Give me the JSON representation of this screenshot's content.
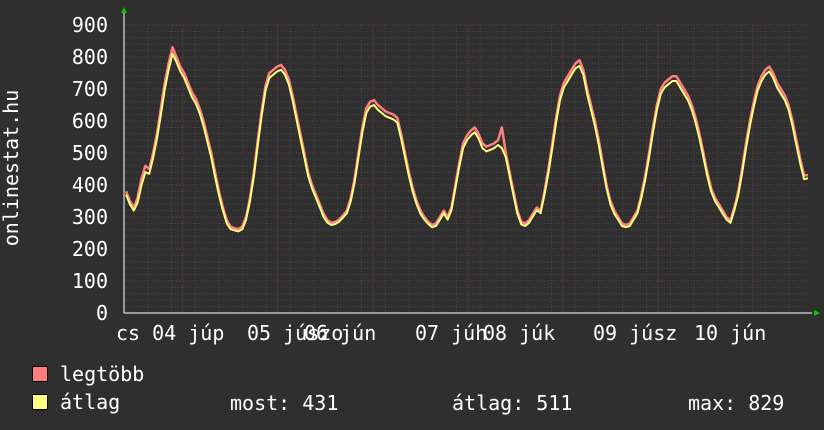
{
  "chart_data": {
    "type": "line",
    "ylabel": "onlinestat.hu",
    "ylim": [
      0,
      900
    ],
    "y_ticks": [
      "0",
      "100",
      "200",
      "300",
      "400",
      "500",
      "600",
      "700",
      "800",
      "900"
    ],
    "x_tick_labels": [
      "cs 04 júp",
      "05 júszo",
      "06 jún",
      "07 júh",
      "08 júk",
      "09 júsz",
      "10 jún"
    ],
    "series": [
      {
        "name": "legtöbb",
        "color": "#ff7f7f",
        "values": [
          380,
          350,
          330,
          360,
          420,
          460,
          450,
          500,
          560,
          640,
          720,
          780,
          830,
          800,
          770,
          750,
          720,
          690,
          670,
          640,
          600,
          550,
          500,
          440,
          380,
          330,
          290,
          270,
          265,
          262,
          270,
          300,
          360,
          440,
          540,
          630,
          710,
          750,
          760,
          770,
          775,
          760,
          730,
          680,
          620,
          560,
          500,
          440,
          400,
          370,
          340,
          310,
          290,
          282,
          285,
          292,
          305,
          320,
          360,
          420,
          500,
          580,
          640,
          660,
          665,
          650,
          640,
          630,
          625,
          620,
          610,
          560,
          500,
          440,
          390,
          350,
          320,
          300,
          285,
          275,
          280,
          300,
          320,
          300,
          330,
          400,
          470,
          530,
          555,
          570,
          580,
          560,
          530,
          520,
          525,
          530,
          540,
          580,
          500,
          440,
          380,
          320,
          285,
          280,
          290,
          310,
          330,
          320,
          380,
          450,
          530,
          610,
          680,
          720,
          740,
          760,
          780,
          790,
          760,
          700,
          650,
          600,
          540,
          470,
          400,
          350,
          320,
          300,
          280,
          275,
          280,
          300,
          320,
          370,
          430,
          500,
          580,
          650,
          700,
          720,
          730,
          740,
          740,
          720,
          700,
          680,
          650,
          610,
          560,
          500,
          440,
          390,
          360,
          340,
          320,
          300,
          290,
          330,
          380,
          450,
          530,
          600,
          660,
          710,
          740,
          760,
          770,
          750,
          720,
          700,
          680,
          650,
          600,
          540,
          480,
          430,
          431
        ]
      },
      {
        "name": "átlag",
        "color": "#ffff7f",
        "values": [
          370,
          340,
          320,
          345,
          400,
          440,
          435,
          485,
          545,
          620,
          700,
          760,
          810,
          785,
          755,
          735,
          705,
          675,
          655,
          625,
          585,
          535,
          485,
          425,
          368,
          320,
          280,
          262,
          258,
          255,
          262,
          292,
          350,
          428,
          525,
          615,
          695,
          735,
          745,
          755,
          760,
          745,
          715,
          665,
          605,
          545,
          487,
          428,
          390,
          360,
          330,
          300,
          282,
          275,
          278,
          285,
          298,
          312,
          350,
          408,
          487,
          565,
          625,
          645,
          650,
          635,
          625,
          615,
          610,
          605,
          595,
          545,
          487,
          428,
          378,
          340,
          310,
          292,
          278,
          268,
          272,
          292,
          312,
          292,
          322,
          390,
          457,
          515,
          540,
          555,
          565,
          545,
          515,
          505,
          510,
          515,
          525,
          515,
          487,
          428,
          368,
          310,
          277,
          272,
          282,
          302,
          322,
          312,
          370,
          437,
          515,
          595,
          665,
          705,
          725,
          745,
          765,
          772,
          745,
          685,
          635,
          585,
          525,
          457,
          390,
          340,
          310,
          292,
          272,
          268,
          272,
          292,
          312,
          360,
          418,
          487,
          565,
          635,
          685,
          705,
          715,
          725,
          725,
          705,
          685,
          665,
          635,
          595,
          545,
          487,
          428,
          380,
          350,
          330,
          310,
          292,
          282,
          322,
          370,
          437,
          515,
          585,
          645,
          695,
          725,
          745,
          755,
          735,
          705,
          685,
          665,
          635,
          585,
          525,
          467,
          418,
          421
        ]
      }
    ]
  },
  "legend": [
    {
      "label": "legtöbb",
      "color": "#ff7f7f"
    },
    {
      "label": "átlag",
      "color": "#ffff7f"
    }
  ],
  "stats": {
    "now": "most: 431",
    "avg": "átlag: 511",
    "max": "max: 829"
  }
}
